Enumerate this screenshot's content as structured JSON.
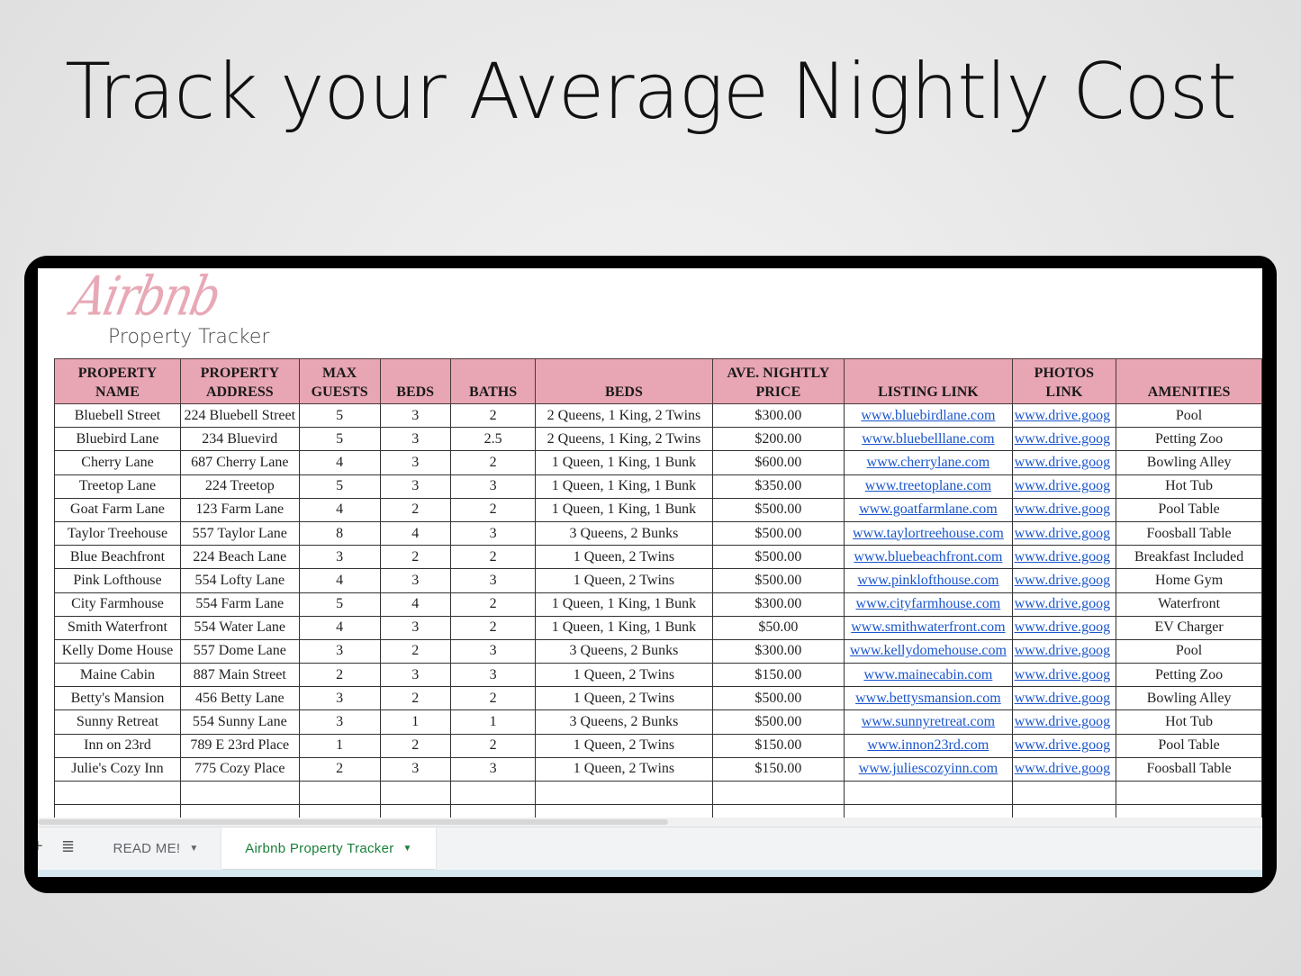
{
  "headline": "Track your Average Nightly Cost",
  "logo": {
    "script": "Airbnb",
    "subtitle": "Property Tracker"
  },
  "table": {
    "headers": [
      "PROPERTY NAME",
      "PROPERTY ADDRESS",
      "MAX GUESTS",
      "BEDS",
      "BATHS",
      "BEDS",
      "AVE. NIGHTLY PRICE",
      "LISTING LINK",
      "PHOTOS LINK",
      "AMENITIES"
    ],
    "rows": [
      [
        "Bluebell Street",
        "224 Bluebell Street",
        "5",
        "3",
        "2",
        "2 Queens, 1 King, 2 Twins",
        "$300.00",
        "www.bluebirdlane.com",
        "www.drive.goog",
        "Pool"
      ],
      [
        "Bluebird Lane",
        "234 Bluevird",
        "5",
        "3",
        "2.5",
        "2 Queens, 1 King, 2 Twins",
        "$200.00",
        "www.bluebelllane.com",
        "www.drive.goog",
        "Petting Zoo"
      ],
      [
        "Cherry Lane",
        "687 Cherry Lane",
        "4",
        "3",
        "2",
        "1 Queen, 1 King, 1 Bunk",
        "$600.00",
        "www.cherrylane.com",
        "www.drive.goog",
        "Bowling Alley"
      ],
      [
        "Treetop Lane",
        "224 Treetop",
        "5",
        "3",
        "3",
        "1 Queen, 1 King, 1 Bunk",
        "$350.00",
        "www.treetoplane.com",
        "www.drive.goog",
        "Hot Tub"
      ],
      [
        "Goat Farm Lane",
        "123 Farm Lane",
        "4",
        "2",
        "2",
        "1 Queen, 1 King, 1 Bunk",
        "$500.00",
        "www.goatfarmlane.com",
        "www.drive.goog",
        "Pool Table"
      ],
      [
        "Taylor Treehouse",
        "557 Taylor Lane",
        "8",
        "4",
        "3",
        "3 Queens, 2 Bunks",
        "$500.00",
        "www.taylortreehouse.com",
        "www.drive.goog",
        "Foosball Table"
      ],
      [
        "Blue Beachfront",
        "224 Beach Lane",
        "3",
        "2",
        "2",
        "1 Queen, 2 Twins",
        "$500.00",
        "www.bluebeachfront.com",
        "www.drive.goog",
        "Breakfast Included"
      ],
      [
        "Pink Lofthouse",
        "554 Lofty Lane",
        "4",
        "3",
        "3",
        "1 Queen, 2 Twins",
        "$500.00",
        "www.pinklofthouse.com",
        "www.drive.goog",
        "Home Gym"
      ],
      [
        "City Farmhouse",
        "554 Farm Lane",
        "5",
        "4",
        "2",
        "1 Queen, 1 King, 1 Bunk",
        "$300.00",
        "www.cityfarmhouse.com",
        "www.drive.goog",
        "Waterfront"
      ],
      [
        "Smith Waterfront",
        "554 Water Lane",
        "4",
        "3",
        "2",
        "1 Queen, 1 King, 1 Bunk",
        "$50.00",
        "www.smithwaterfront.com",
        "www.drive.goog",
        "EV Charger"
      ],
      [
        "Kelly Dome House",
        "557 Dome Lane",
        "3",
        "2",
        "3",
        "3 Queens, 2 Bunks",
        "$300.00",
        "www.kellydomehouse.com",
        "www.drive.goog",
        "Pool"
      ],
      [
        "Maine Cabin",
        "887 Main Street",
        "2",
        "3",
        "3",
        "1 Queen, 2 Twins",
        "$150.00",
        "www.mainecabin.com",
        "www.drive.goog",
        "Petting Zoo"
      ],
      [
        "Betty's Mansion",
        "456 Betty Lane",
        "3",
        "2",
        "2",
        "1 Queen, 2 Twins",
        "$500.00",
        "www.bettysmansion.com",
        "www.drive.goog",
        "Bowling Alley"
      ],
      [
        "Sunny Retreat",
        "554 Sunny Lane",
        "3",
        "1",
        "1",
        "3 Queens, 2 Bunks",
        "$500.00",
        "www.sunnyretreat.com",
        "www.drive.goog",
        "Hot Tub"
      ],
      [
        "Inn on 23rd",
        "789 E 23rd Place",
        "1",
        "2",
        "2",
        "1 Queen, 2 Twins",
        "$150.00",
        "www.innon23rd.com",
        "www.drive.goog",
        "Pool Table"
      ],
      [
        "Julie's Cozy Inn",
        "775 Cozy Place",
        "2",
        "3",
        "3",
        "1 Queen, 2 Twins",
        "$150.00",
        "www.juliescozyinn.com",
        "www.drive.goog",
        "Foosball Table"
      ]
    ],
    "empty_rows": 2
  },
  "sheet_tabs": {
    "add_icon": "+",
    "list_icon": "≣",
    "tabs": [
      {
        "label": "READ ME!",
        "active": false
      },
      {
        "label": "Airbnb Property Tracker",
        "active": true
      }
    ],
    "caret": "▼"
  },
  "colors": {
    "header_fill": "#e8a5b3",
    "link": "#1a55cc",
    "active_tab": "#188038"
  }
}
